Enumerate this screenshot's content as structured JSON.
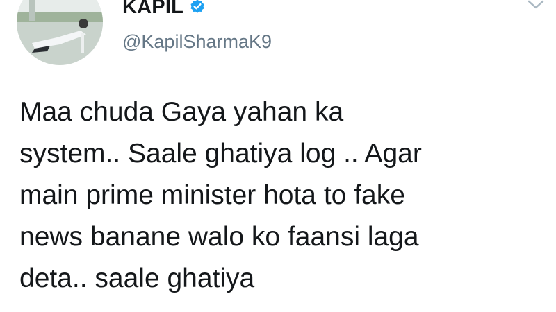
{
  "profile": {
    "display_name": "KAPIL",
    "handle": "@KapilSharmaK9",
    "verified_icon": "verified-badge-icon",
    "avatar": "profile-avatar"
  },
  "tweet": {
    "text_lines": [
      "Maa chuda Gaya yahan ka",
      "system.. Saale ghatiya log .. Agar",
      "main prime minister hota to fake",
      "news banane walo ko faansi laga",
      "deta.. saale ghatiya"
    ]
  },
  "menu": {
    "icon": "chevron-down-icon"
  },
  "colors": {
    "verified": "#1da1f2",
    "handle": "#657786",
    "text": "#14171a"
  }
}
